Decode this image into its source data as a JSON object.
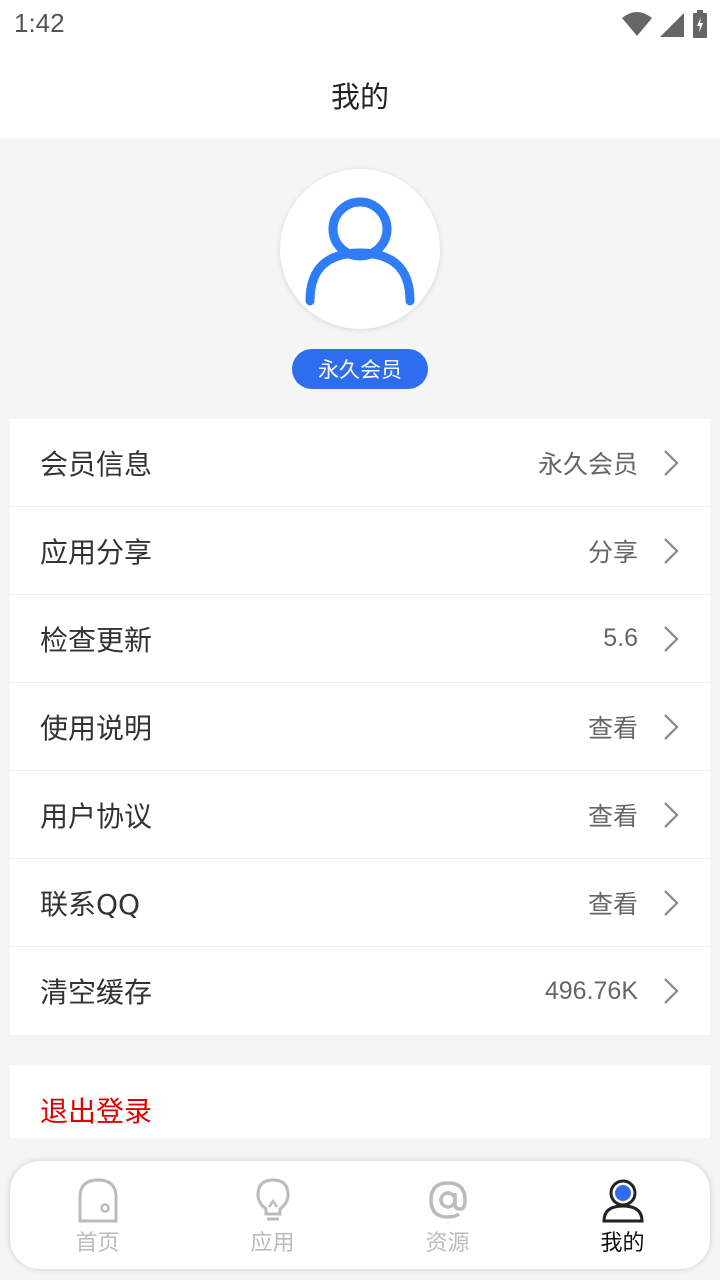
{
  "status_bar": {
    "time": "1:42"
  },
  "header": {
    "title": "我的"
  },
  "profile": {
    "badge": "永久会员"
  },
  "menu": [
    {
      "label": "会员信息",
      "value": "永久会员"
    },
    {
      "label": "应用分享",
      "value": "分享"
    },
    {
      "label": "检查更新",
      "value": "5.6"
    },
    {
      "label": "使用说明",
      "value": "查看"
    },
    {
      "label": "用户协议",
      "value": "查看"
    },
    {
      "label": "联系QQ",
      "value": "查看"
    },
    {
      "label": "清空缓存",
      "value": "496.76K"
    }
  ],
  "logout": {
    "label": "退出登录"
  },
  "tabs": [
    {
      "label": "首页",
      "icon": "home-icon"
    },
    {
      "label": "应用",
      "icon": "lightbulb-icon"
    },
    {
      "label": "资源",
      "icon": "at-icon"
    },
    {
      "label": "我的",
      "icon": "profile-icon"
    }
  ],
  "colors": {
    "accent": "#2e6cf0",
    "danger": "#e10000"
  }
}
